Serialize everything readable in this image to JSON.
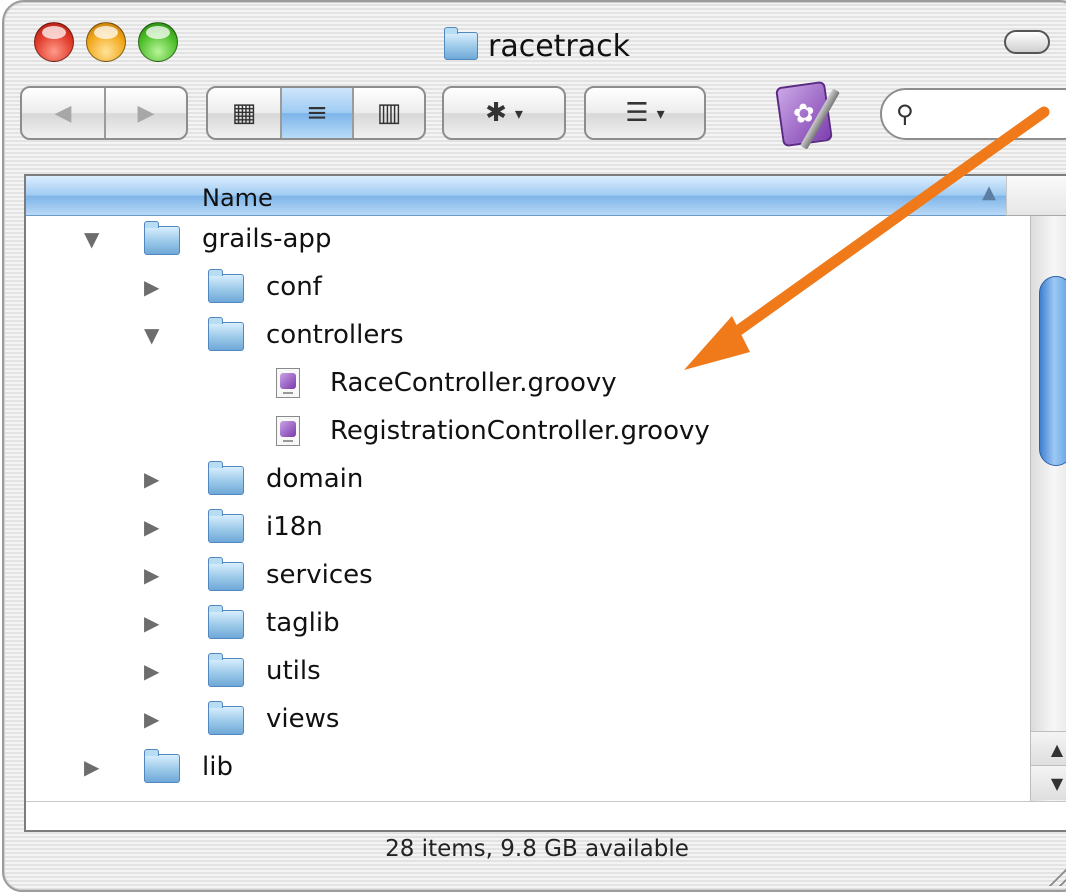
{
  "window": {
    "title": "racetrack"
  },
  "toolbar": {
    "back_label": "◀",
    "forward_label": "▶",
    "view_icon_label": "▦",
    "view_list_label": "≡",
    "view_column_label": "▥",
    "action_label": "✱",
    "arrange_label": "☰",
    "dropdown_caret": "▾",
    "search_placeholder": "",
    "search_glyph": "🔍"
  },
  "list": {
    "column_header": "Name",
    "sort_indicator": "▲",
    "rows": [
      {
        "name": "grails-app",
        "expanded": true,
        "kind": "folder",
        "depth": 0
      },
      {
        "name": "conf",
        "expanded": false,
        "kind": "folder",
        "depth": 1
      },
      {
        "name": "controllers",
        "expanded": true,
        "kind": "folder",
        "depth": 1
      },
      {
        "name": "RaceController.groovy",
        "kind": "file",
        "depth": 2
      },
      {
        "name": "RegistrationController.groovy",
        "kind": "file",
        "depth": 2
      },
      {
        "name": "domain",
        "expanded": false,
        "kind": "folder",
        "depth": 1
      },
      {
        "name": "i18n",
        "expanded": false,
        "kind": "folder",
        "depth": 1
      },
      {
        "name": "services",
        "expanded": false,
        "kind": "folder",
        "depth": 1
      },
      {
        "name": "taglib",
        "expanded": false,
        "kind": "folder",
        "depth": 1
      },
      {
        "name": "utils",
        "expanded": false,
        "kind": "folder",
        "depth": 1
      },
      {
        "name": "views",
        "expanded": false,
        "kind": "folder",
        "depth": 1
      },
      {
        "name": "lib",
        "expanded": false,
        "kind": "folder",
        "depth": 0
      }
    ],
    "expanded_glyph": "▼",
    "collapsed_glyph": "▶"
  },
  "scroll": {
    "up_label": "▲",
    "down_label": "▼"
  },
  "status": {
    "text": "28 items, 9.8 GB available"
  },
  "colors": {
    "callout_arrow": "#f07a1a",
    "selection_blue": "#7db4e8"
  }
}
